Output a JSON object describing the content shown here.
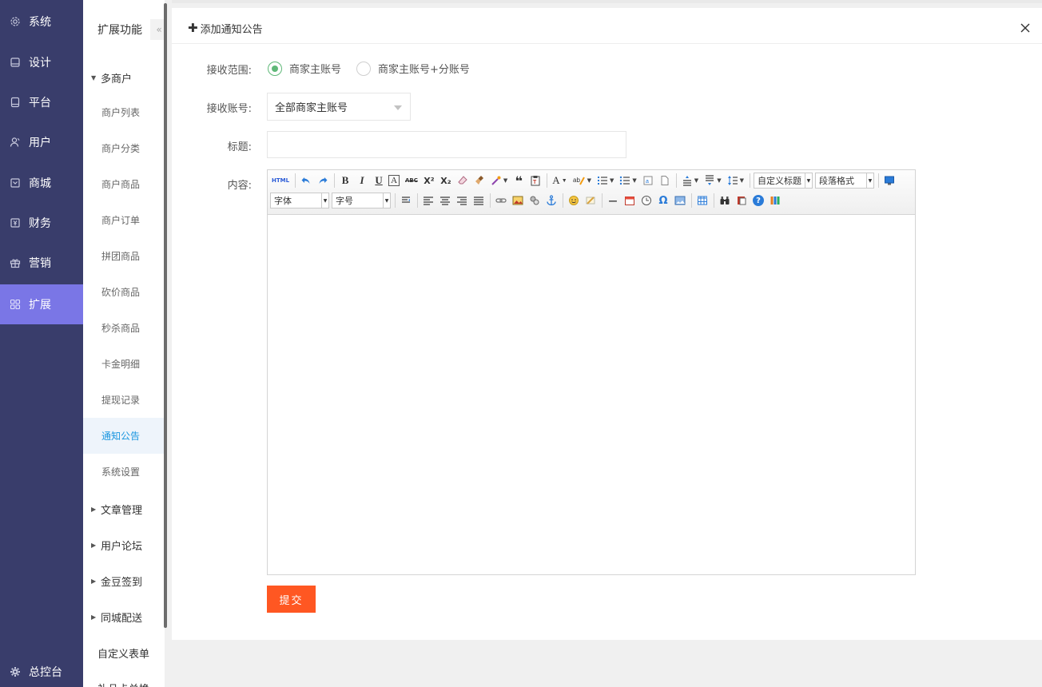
{
  "sidebar": {
    "items": [
      {
        "label": "系统",
        "icon": "gear-icon"
      },
      {
        "label": "设计",
        "icon": "design-icon"
      },
      {
        "label": "平台",
        "icon": "tablet-icon"
      },
      {
        "label": "用户",
        "icon": "user-icon"
      },
      {
        "label": "商城",
        "icon": "store-icon"
      },
      {
        "label": "财务",
        "icon": "finance-icon"
      },
      {
        "label": "营销",
        "icon": "gift-icon"
      },
      {
        "label": "扩展",
        "icon": "grid-icon"
      }
    ],
    "active": "扩展",
    "bottom_label": "总控台"
  },
  "subsidebar": {
    "title": "扩展功能",
    "collapse_glyph": "«",
    "group_multi_merchant": "多商户",
    "items": [
      "商户列表",
      "商户分类",
      "商户商品",
      "商户订单",
      "拼团商品",
      "砍价商品",
      "秒杀商品",
      "卡金明细",
      "提现记录",
      "通知公告",
      "系统设置"
    ],
    "active_item": "通知公告",
    "groups": [
      "文章管理",
      "用户论坛",
      "金豆签到",
      "同城配送"
    ],
    "plain_items": [
      "自定义表单",
      "礼品卡兑换"
    ]
  },
  "panel": {
    "title": "添加通知公告",
    "plus_glyph": "✚"
  },
  "form": {
    "scope_label": "接收范围:",
    "scope_options": [
      "商家主账号",
      "商家主账号+分账号"
    ],
    "scope_selected": "商家主账号",
    "account_label": "接收账号:",
    "account_value": "全部商家主账号",
    "title_label": "标题:",
    "title_value": "",
    "content_label": "内容:",
    "submit_label": "提交"
  },
  "editor": {
    "html_label": "HTML",
    "font_combo": "字体",
    "size_combo": "字号",
    "custom_title_combo": "自定义标题",
    "paragraph_combo": "段落格式",
    "glyph_bold": "B",
    "glyph_italic": "I",
    "glyph_underline": "U",
    "glyph_border": "A",
    "glyph_strike": "ABC",
    "glyph_sup": "X²",
    "glyph_sub": "X₂",
    "glyph_quote": "❝",
    "glyph_color": "A",
    "glyph_omega": "Ω",
    "glyph_help": "?",
    "glyph_line": "—"
  },
  "colors": {
    "sidebar_bg": "#393d6b",
    "sidebar_active": "#7a76e6",
    "submit": "#ff5722",
    "radio_checked": "#5fb878",
    "link_active": "#1a96e0"
  }
}
